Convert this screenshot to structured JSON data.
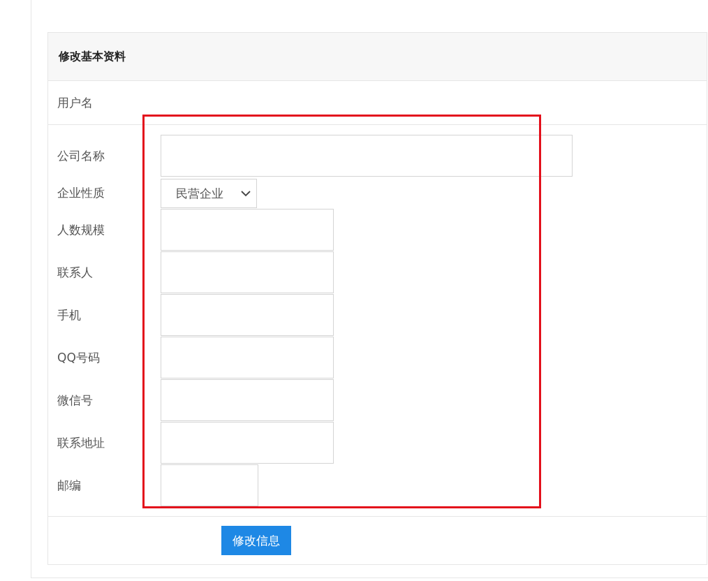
{
  "panel": {
    "title": "修改基本资料"
  },
  "username": {
    "label": "用户名"
  },
  "fields": [
    {
      "label": "公司名称",
      "kind": "wide"
    },
    {
      "label": "企业性质",
      "kind": "select",
      "value": "民营企业"
    },
    {
      "label": "人数规模",
      "kind": "text"
    },
    {
      "label": "联系人",
      "kind": "text"
    },
    {
      "label": "手机",
      "kind": "text"
    },
    {
      "label": "QQ号码",
      "kind": "text"
    },
    {
      "label": "微信号",
      "kind": "text"
    },
    {
      "label": "联系地址",
      "kind": "text"
    },
    {
      "label": "邮编",
      "kind": "short"
    }
  ],
  "highlight": {
    "color": "#e3101c"
  },
  "submit": {
    "label": "修改信息"
  }
}
